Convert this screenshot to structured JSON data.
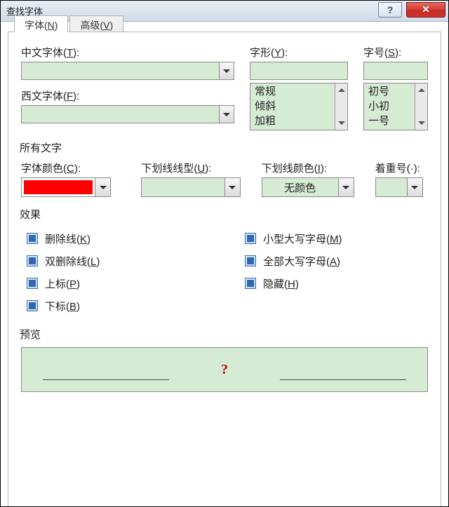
{
  "window": {
    "title": "查找字体",
    "help_symbol": "?",
    "close_symbol": "✕"
  },
  "tabs": {
    "font": {
      "label_pre": "字体(",
      "label_key": "N",
      "label_post": ")"
    },
    "advanced": {
      "label_pre": "高级(",
      "label_key": "V",
      "label_post": ")"
    }
  },
  "labels": {
    "asian_font": {
      "pre": "中文字体(",
      "key": "T",
      "post": "):"
    },
    "latin_font": {
      "pre": "西文字体(",
      "key": "F",
      "post": "):"
    },
    "font_style": {
      "pre": "字形(",
      "key": "Y",
      "post": "):"
    },
    "font_size": {
      "pre": "字号(",
      "key": "S",
      "post": "):"
    },
    "all_text": "所有文字",
    "font_color": {
      "pre": "字体颜色(",
      "key": "C",
      "post": "):"
    },
    "under_style": {
      "pre": "下划线线型(",
      "key": "U",
      "post": "):"
    },
    "under_color": {
      "pre": "下划线颜色(",
      "key": "I",
      "post": "):"
    },
    "emphasis": {
      "pre": "着重号(",
      "key": "·",
      "post": "):"
    },
    "effects": "效果",
    "preview": "预览"
  },
  "style_list": [
    "常规",
    "倾斜",
    "加粗"
  ],
  "size_list": [
    "初号",
    "小初",
    "一号"
  ],
  "under_color_value": "无颜色",
  "font_color_hex": "#ff0000",
  "effects_left": [
    {
      "pre": "删除线(",
      "key": "K",
      "post": ")"
    },
    {
      "pre": "双删除线(",
      "key": "L",
      "post": ")"
    },
    {
      "pre": "上标(",
      "key": "P",
      "post": ")"
    },
    {
      "pre": "下标(",
      "key": "B",
      "post": ")"
    }
  ],
  "effects_right": [
    {
      "pre": "小型大写字母(",
      "key": "M",
      "post": ")"
    },
    {
      "pre": "全部大写字母(",
      "key": "A",
      "post": ")"
    },
    {
      "pre": "隐藏(",
      "key": "H",
      "post": ")"
    }
  ],
  "preview_text": "?"
}
